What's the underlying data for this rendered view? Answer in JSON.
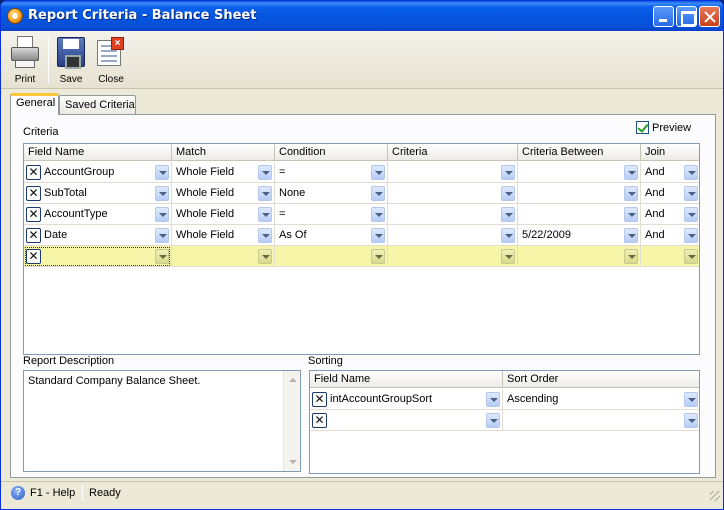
{
  "window": {
    "title": "Report Criteria - Balance Sheet"
  },
  "toolbar": {
    "print_label": "Print",
    "save_label": "Save",
    "close_label": "Close"
  },
  "tabs": [
    {
      "label": "General",
      "active": true
    },
    {
      "label": "Saved Criteria",
      "active": false
    }
  ],
  "criteria": {
    "section_label": "Criteria",
    "preview_label": "Preview",
    "preview_checked": true,
    "columns": [
      "Field Name",
      "Match",
      "Condition",
      "Criteria",
      "Criteria Between",
      "Join"
    ],
    "rows": [
      {
        "field_name": "AccountGroup",
        "match": "Whole Field",
        "condition": "=",
        "criteria": "",
        "criteria_between": "",
        "join": "And"
      },
      {
        "field_name": "SubTotal",
        "match": "Whole Field",
        "condition": "None",
        "criteria": "",
        "criteria_between": "",
        "join": "And"
      },
      {
        "field_name": "AccountType",
        "match": "Whole Field",
        "condition": "=",
        "criteria": "",
        "criteria_between": "",
        "join": "And"
      },
      {
        "field_name": "Date",
        "match": "Whole Field",
        "condition": "As Of",
        "criteria": "",
        "criteria_between": "5/22/2009",
        "join": "And"
      },
      {
        "field_name": "",
        "match": "",
        "condition": "",
        "criteria": "",
        "criteria_between": "",
        "join": ""
      }
    ]
  },
  "report_description": {
    "label": "Report Description",
    "text": "Standard Company Balance Sheet."
  },
  "sorting": {
    "label": "Sorting",
    "columns": [
      "Field Name",
      "Sort Order"
    ],
    "rows": [
      {
        "field_name": "intAccountGroupSort",
        "sort_order": "Ascending"
      },
      {
        "field_name": "",
        "sort_order": ""
      }
    ]
  },
  "statusbar": {
    "help_text": "F1 - Help",
    "status": "Ready"
  },
  "colors": {
    "title_bar": "#0454e0",
    "new_row_highlight": "#f7f5a8",
    "active_tab_accent": "#ffc83c",
    "preview_check": "#21a121"
  }
}
